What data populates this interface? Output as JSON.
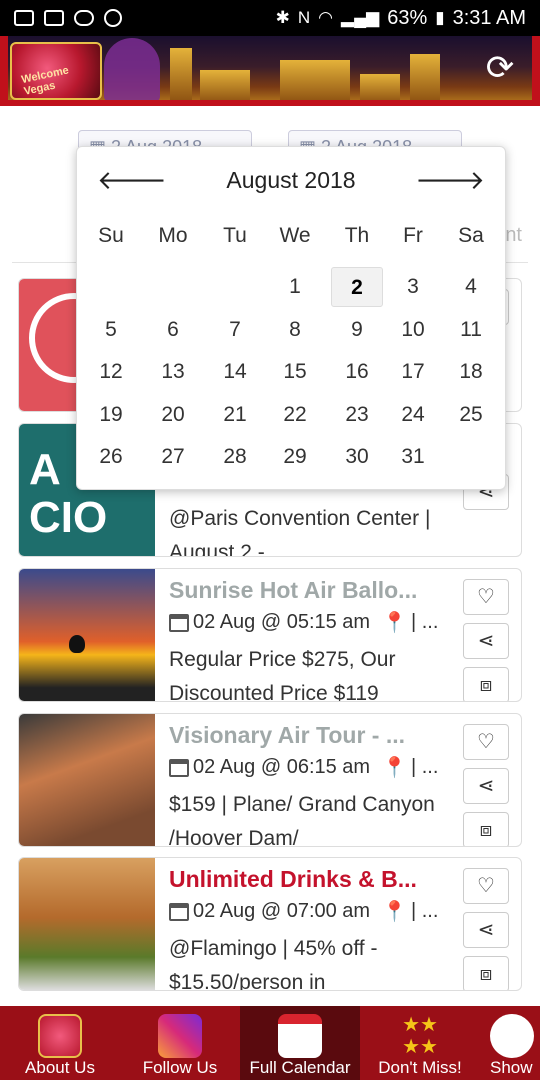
{
  "status_bar": {
    "battery": "63%",
    "time": "3:31 AM"
  },
  "filters": {
    "start_date": "2 Aug 2018",
    "end_date": "2 Aug 2018",
    "tab_hint": "nt"
  },
  "calendar": {
    "month_label": "August 2018",
    "prev_icon": "arrow-left-icon",
    "next_icon": "arrow-right-icon",
    "weekdays": [
      "Su",
      "Mo",
      "Tu",
      "We",
      "Th",
      "Fr",
      "Sa"
    ],
    "days": [
      "1",
      "2",
      "3",
      "4",
      "5",
      "6",
      "7",
      "8",
      "9",
      "10",
      "11",
      "12",
      "13",
      "14",
      "15",
      "16",
      "17",
      "18",
      "19",
      "20",
      "21",
      "22",
      "23",
      "24",
      "25",
      "26",
      "27",
      "28",
      "29",
      "30",
      "31"
    ],
    "selected_day": "2"
  },
  "events": [
    {
      "title": "",
      "meta_date": "",
      "desc": "",
      "thumb_color": "#e0525b"
    },
    {
      "title": "",
      "meta_date": "",
      "desc": "@Paris Convention Center | August 2 -",
      "thumb_color": "#1e6e6c",
      "thumb_text_1": "A",
      "thumb_text_2": "CIO"
    },
    {
      "title": "Sunrise Hot Air Ballo...",
      "meta_date": "02 Aug @ 05:15 am",
      "meta_loc": "| ...",
      "desc": "Regular Price $275, Our Discounted Price $119",
      "thumb_color": "#f08a18"
    },
    {
      "title": "Visionary Air Tour - ...",
      "meta_date": "02 Aug @ 06:15 am",
      "meta_loc": "| ...",
      "desc": "$159 | Plane/ Grand Canyon /Hoover Dam/",
      "thumb_color": "#7a4a30"
    },
    {
      "title": "Unlimited Drinks & B...",
      "meta_date": "02 Aug @ 07:00 am",
      "meta_loc": "| ...",
      "desc": "@Flamingo | 45% off - $15.50/person in",
      "thumb_color": "#b46a2c"
    }
  ],
  "nav": [
    {
      "label": "About Us",
      "icon": "vegas-logo-icon"
    },
    {
      "label": "Follow Us",
      "icon": "instagram-icon"
    },
    {
      "label": "Full Calendar",
      "icon": "calendar-icon"
    },
    {
      "label": "Don't Miss!",
      "icon": "stars-icon"
    },
    {
      "label": "Show",
      "icon": "masks-icon"
    }
  ]
}
